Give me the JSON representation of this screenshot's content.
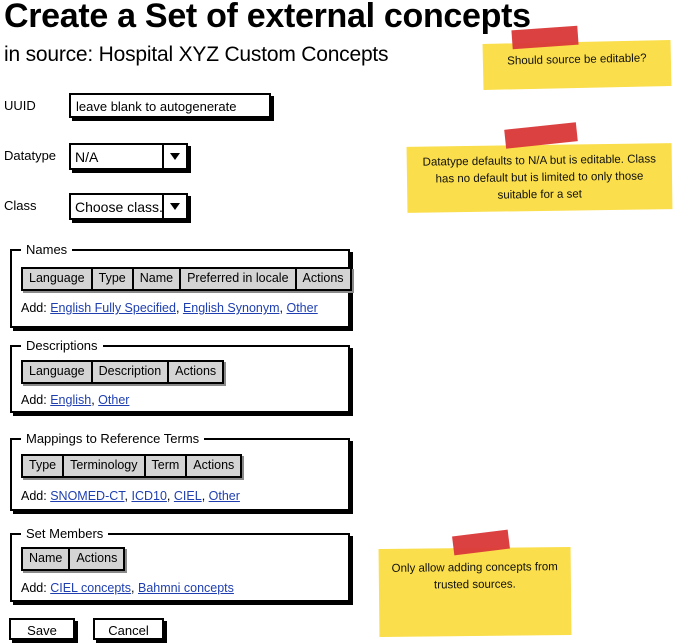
{
  "header": {
    "title": "Create a Set of external concepts",
    "subtitle": "in source: Hospital XYZ Custom Concepts"
  },
  "form": {
    "uuid": {
      "label": "UUID",
      "value": "leave blank to autogenerate"
    },
    "datatype": {
      "label": "Datatype",
      "value": "N/A",
      "arrow_icon": "chevron-down-icon"
    },
    "class": {
      "label": "Class",
      "value": "Choose class...",
      "arrow_icon": "chevron-down-icon"
    }
  },
  "sections": {
    "names": {
      "legend": "Names",
      "columns": [
        "Language",
        "Type",
        "Name",
        "Preferred in locale",
        "Actions"
      ],
      "add_label": "Add:",
      "add_links": [
        "English Fully Specified",
        "English Synonym",
        "Other"
      ]
    },
    "descriptions": {
      "legend": "Descriptions",
      "columns": [
        "Language",
        "Description",
        "Actions"
      ],
      "add_label": "Add:",
      "add_links": [
        "English",
        "Other"
      ]
    },
    "mappings": {
      "legend": "Mappings to Reference Terms",
      "columns": [
        "Type",
        "Terminology",
        "Term",
        "Actions"
      ],
      "add_label": "Add:",
      "add_links": [
        "SNOMED-CT",
        "ICD10",
        "CIEL",
        "Other"
      ]
    },
    "set_members": {
      "legend": "Set Members",
      "columns": [
        "Name",
        "Actions"
      ],
      "add_label": "Add:",
      "add_links": [
        "CIEL concepts",
        "Bahmni concepts"
      ]
    }
  },
  "actions": {
    "save_label": "Save",
    "cancel_label": "Cancel"
  },
  "notes": [
    {
      "text": "Should source be editable?"
    },
    {
      "text": "Datatype defaults to N/A but is editable. Class has no default but is limited to only those suitable for a set"
    },
    {
      "text": "Only allow adding concepts from trusted sources."
    }
  ],
  "colors": {
    "sticky_yellow": "#fade4b",
    "tape_red": "#db3b3b",
    "link_blue": "#1f3fb0",
    "table_header_grey": "#d4d4d4",
    "outline_black": "#000000"
  }
}
